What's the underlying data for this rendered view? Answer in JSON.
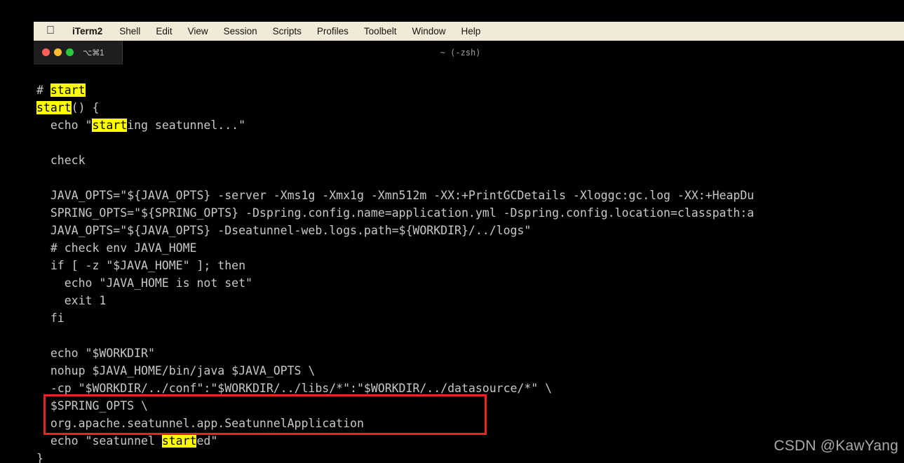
{
  "menubar": {
    "items": [
      {
        "label": "",
        "name": "apple-menu",
        "style": "apple"
      },
      {
        "label": "iTerm2",
        "name": "menu-iterm2",
        "style": "bold"
      },
      {
        "label": "Shell",
        "name": "menu-shell",
        "style": "normal"
      },
      {
        "label": "Edit",
        "name": "menu-edit",
        "style": "normal"
      },
      {
        "label": "View",
        "name": "menu-view",
        "style": "normal"
      },
      {
        "label": "Session",
        "name": "menu-session",
        "style": "normal"
      },
      {
        "label": "Scripts",
        "name": "menu-scripts",
        "style": "normal"
      },
      {
        "label": "Profiles",
        "name": "menu-profiles",
        "style": "normal"
      },
      {
        "label": "Toolbelt",
        "name": "menu-toolbelt",
        "style": "normal"
      },
      {
        "label": "Window",
        "name": "menu-window",
        "style": "normal"
      },
      {
        "label": "Help",
        "name": "menu-help",
        "style": "normal"
      }
    ]
  },
  "window": {
    "title": "~ (-zsh)",
    "tab_label": "⌥⌘1",
    "traffic_lights": [
      "close-button",
      "minimize-button",
      "zoom-button"
    ]
  },
  "terminal": {
    "search_term": "start",
    "highlight_color": "#ffff00",
    "foreground_color": "#c8c8c8",
    "background_color": "#000000",
    "lines": [
      [
        {
          "t": "# ",
          "h": false
        },
        {
          "t": "start",
          "h": true
        }
      ],
      [
        {
          "t": "start",
          "h": true
        },
        {
          "t": "() {",
          "h": false
        }
      ],
      [
        {
          "t": "  echo \"",
          "h": false
        },
        {
          "t": "start",
          "h": true
        },
        {
          "t": "ing seatunnel...\"",
          "h": false
        }
      ],
      [
        {
          "t": "",
          "h": false
        }
      ],
      [
        {
          "t": "  check",
          "h": false
        }
      ],
      [
        {
          "t": "",
          "h": false
        }
      ],
      [
        {
          "t": "  JAVA_OPTS=\"${JAVA_OPTS} -server -Xms1g -Xmx1g -Xmn512m -XX:+PrintGCDetails -Xloggc:gc.log -XX:+HeapDu",
          "h": false
        }
      ],
      [
        {
          "t": "  SPRING_OPTS=\"${SPRING_OPTS} -Dspring.config.name=application.yml -Dspring.config.location=classpath:a",
          "h": false
        }
      ],
      [
        {
          "t": "  JAVA_OPTS=\"${JAVA_OPTS} -Dseatunnel-web.logs.path=${WORKDIR}/../logs\"",
          "h": false
        }
      ],
      [
        {
          "t": "  # check env JAVA_HOME",
          "h": false
        }
      ],
      [
        {
          "t": "  if [ -z \"$JAVA_HOME\" ]; then",
          "h": false
        }
      ],
      [
        {
          "t": "    echo \"JAVA_HOME is not set\"",
          "h": false
        }
      ],
      [
        {
          "t": "    exit 1",
          "h": false
        }
      ],
      [
        {
          "t": "  fi",
          "h": false
        }
      ],
      [
        {
          "t": "",
          "h": false
        }
      ],
      [
        {
          "t": "  echo \"$WORKDIR\"",
          "h": false
        }
      ],
      [
        {
          "t": "  nohup $JAVA_HOME/bin/java $JAVA_OPTS \\",
          "h": false
        }
      ],
      [
        {
          "t": "  -cp \"$WORKDIR/../conf\":\"$WORKDIR/../libs/*\":\"$WORKDIR/../datasource/*\" \\",
          "h": false
        }
      ],
      [
        {
          "t": "  $SPRING_OPTS \\",
          "h": false
        }
      ],
      [
        {
          "t": "  org.apache.seatunnel.app.SeatunnelApplication",
          "h": false
        }
      ],
      [
        {
          "t": "  echo \"seatunnel ",
          "h": false
        },
        {
          "t": "start",
          "h": true
        },
        {
          "t": "ed\"",
          "h": false
        }
      ],
      [
        {
          "t": "}",
          "h": false
        }
      ]
    ]
  },
  "annotation": {
    "box_color": "#ee2222",
    "boxed_lines": [
      "  $SPRING_OPTS \\",
      "  org.apache.seatunnel.app.SeatunnelApplication"
    ]
  },
  "watermark": {
    "text": "CSDN @KawYang"
  }
}
